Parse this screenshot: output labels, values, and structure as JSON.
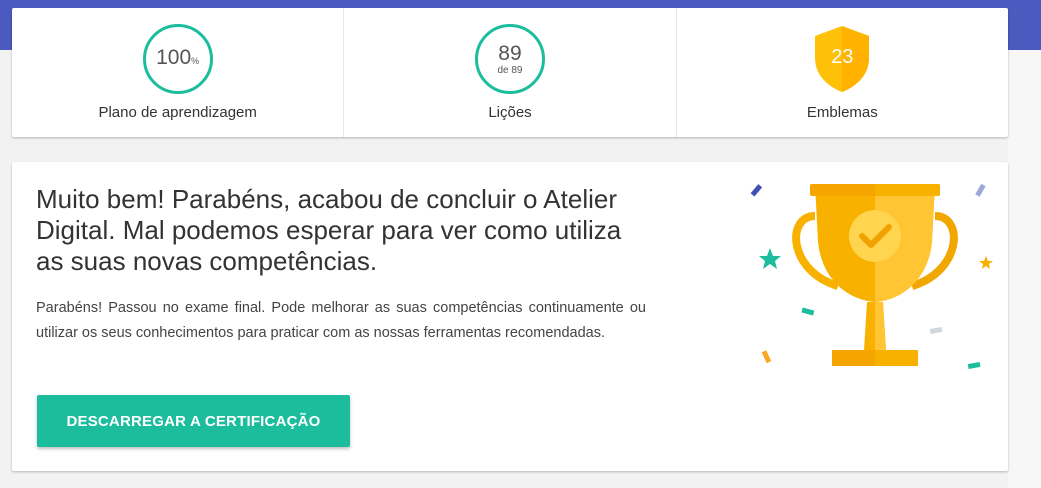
{
  "stats": {
    "plan": {
      "value": "100",
      "unit": "%",
      "label": "Plano de aprendizagem"
    },
    "lessons": {
      "value": "89",
      "sub": "de 89",
      "label": "Lições"
    },
    "badges": {
      "value": "23",
      "label": "Emblemas"
    }
  },
  "main": {
    "headline": "Muito bem! Parabéns, acabou de concluir o Atelier Digital. Mal podemos esperar para ver como utiliza as suas novas competências.",
    "body": "Parabéns! Passou no exame final. Pode melhorar as suas competências continuamente ou utilizar os seus conhecimentos para praticar com as nossas ferramentas recomendadas.",
    "button_label": "DESCARREGAR A CERTIFICAÇÃO"
  },
  "colors": {
    "header_band": "#4a5abf",
    "accent": "#1bbd9d",
    "trophy_gold": "#f9b100",
    "badge_gold": "#ffc107"
  },
  "icons": [
    "shield-badge-icon",
    "trophy-icon",
    "checkmark-icon",
    "confetti-decoration"
  ]
}
